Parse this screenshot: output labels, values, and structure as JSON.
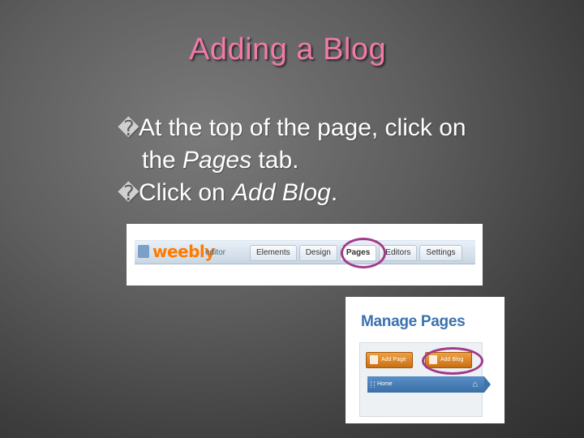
{
  "slide": {
    "title": "Adding a Blog",
    "bullet_glyph": "�",
    "bullets": [
      {
        "pre": "At the top of the page, click on",
        "line2_pre": "the ",
        "em": "Pages",
        "post": " tab."
      },
      {
        "pre": "Click on ",
        "em": "Add  Blog",
        "post": "."
      }
    ]
  },
  "toolbar_shot": {
    "logo": "weebly",
    "logo_sub": "editor",
    "tabs": [
      "Elements",
      "Design",
      "Pages",
      "Editors",
      "Settings"
    ],
    "active_tab": "Pages"
  },
  "manage_pages_shot": {
    "title": "Manage Pages",
    "add_page_label": "Add Page",
    "add_blog_label": "Add Blog",
    "home_label": "Home",
    "home_icon": "house-icon"
  },
  "colors": {
    "title": "#f07aa8",
    "highlight_circle": "#a23a8a",
    "weebly_orange": "#ff7a00",
    "manage_title": "#3a72b0"
  }
}
